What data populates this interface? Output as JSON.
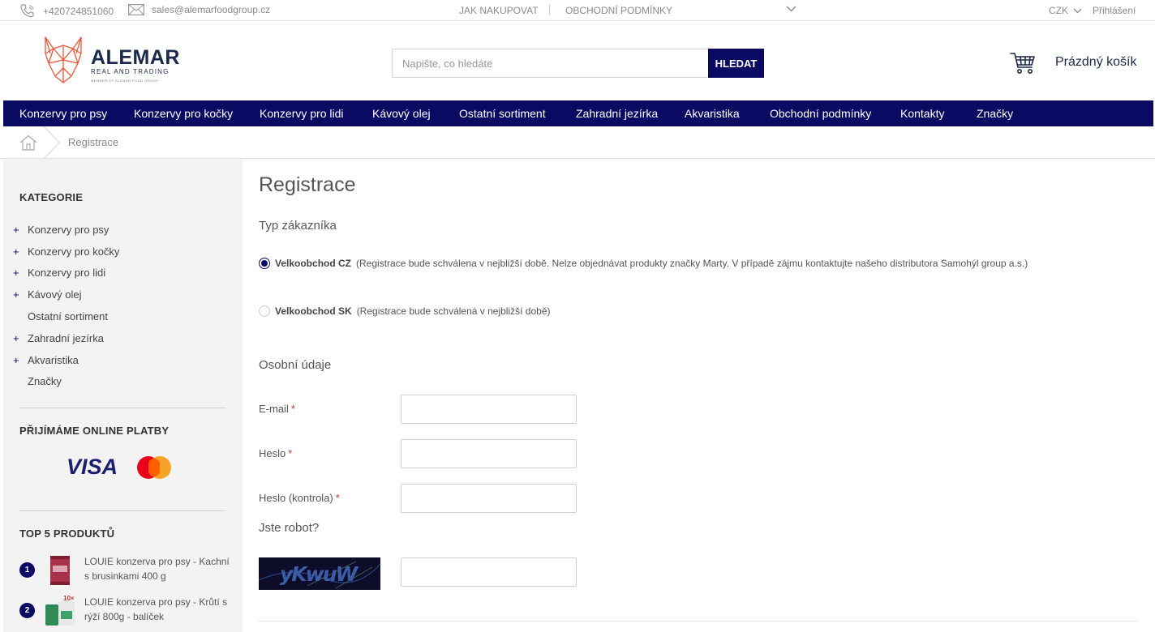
{
  "topbar": {
    "phone": "+420724851060",
    "email": "sales@alemarfoodgroup.cz",
    "link1": "JAK NAKUPOVAT",
    "link2": "OBCHODNÍ PODMÍNKY",
    "currency": "CZK",
    "login": "Přihlášení"
  },
  "logo": {
    "name": "ALEMAR",
    "sub": "REAL AND TRADING",
    "member": "MEMBER OF ALEMAR FOOD GROUP",
    "color": "#e8573a"
  },
  "search": {
    "placeholder": "Napište, co hledáte",
    "button": "HLEDAT"
  },
  "cart": {
    "label": "Prázdný košík"
  },
  "nav": [
    "Konzervy pro psy",
    "Konzervy pro kočky",
    "Konzervy pro lidi",
    "Kávový olej",
    "Ostatní sortiment",
    "Zahradní jezírka",
    "Akvaristika",
    "Obchodní podmínky",
    "Kontakty",
    "Značky"
  ],
  "breadcrumb": {
    "current": "Registrace"
  },
  "sidebar": {
    "categories_title": "KATEGORIE",
    "categories": [
      {
        "label": "Konzervy pro psy",
        "expandable": true
      },
      {
        "label": "Konzervy pro kočky",
        "expandable": true
      },
      {
        "label": "Konzervy pro lidi",
        "expandable": true
      },
      {
        "label": "Kávový olej",
        "expandable": true
      },
      {
        "label": "Ostatní sortiment",
        "expandable": false
      },
      {
        "label": "Zahradní jezírka",
        "expandable": true
      },
      {
        "label": "Akvaristika",
        "expandable": true
      },
      {
        "label": "Značky",
        "expandable": false
      }
    ],
    "payments_title": "PŘIJÍMÁME ONLINE PLATBY",
    "visa": "VISA",
    "top_title": "TOP 5 PRODUKTŮ",
    "top": [
      {
        "rank": "1",
        "name": "LOUIE konzerva pro psy - Kachní s brusinkami 400 g"
      },
      {
        "rank": "2",
        "name": "LOUIE konzerva pro psy - Krůtí s rýží 800g - balíček"
      }
    ],
    "plus": "+"
  },
  "main": {
    "title": "Registrace",
    "customer_type": "Typ zákazníka",
    "options": [
      {
        "name": "Velkoobchod CZ",
        "desc": "(Registrace bude schválena v nejbližší době. Nelze objednávat produkty značky Marty. V případě zájmu kontaktujte našeho distributora Samohýl group a.s.)",
        "selected": true
      },
      {
        "name": "Velkoobchod SK",
        "desc": "(Registrace bude schválená v nejbližší době)",
        "selected": false
      }
    ],
    "personal": "Osobní údaje",
    "fields": [
      {
        "label": "E-mail",
        "required": "*"
      },
      {
        "label": "Heslo",
        "required": "*"
      },
      {
        "label": "Heslo (kontrola)",
        "required": "*"
      }
    ],
    "robot": "Jste robot?",
    "captcha_text": "yKwuW"
  },
  "colors": {
    "navy": "#0a0a63",
    "required": "#c0392b"
  }
}
